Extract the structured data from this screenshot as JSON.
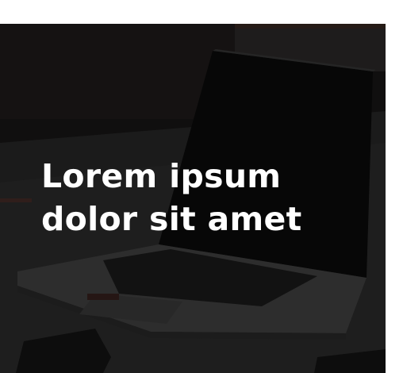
{
  "hero": {
    "title_line1": "Lorem ipsum",
    "title_line2": "dolor sit amet",
    "image": "laptop-on-desk-photo",
    "overlay_color": "#000000"
  }
}
